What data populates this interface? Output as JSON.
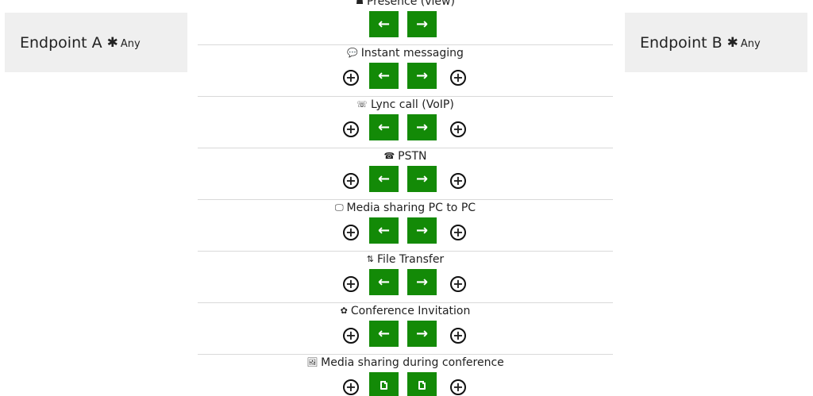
{
  "endpoint_a": {
    "title": "Endpoint A",
    "star": "✱",
    "scope": "Any"
  },
  "endpoint_b": {
    "title": "Endpoint B",
    "star": "✱",
    "scope": "Any"
  },
  "features": [
    {
      "label": "Presence (view)",
      "icon": "presence-icon",
      "glyph": "☗",
      "has_add": false,
      "button_type": "arrows"
    },
    {
      "label": "Instant messaging",
      "icon": "chat-icon",
      "glyph": "💬",
      "has_add": true,
      "button_type": "arrows"
    },
    {
      "label": "Lync call (VoIP)",
      "icon": "phone-icon",
      "glyph": "☏",
      "has_add": true,
      "button_type": "arrows"
    },
    {
      "label": "PSTN",
      "icon": "pstn-icon",
      "glyph": "☎",
      "has_add": true,
      "button_type": "arrows"
    },
    {
      "label": "Media sharing PC to PC",
      "icon": "monitor-icon",
      "glyph": "🖵",
      "has_add": true,
      "button_type": "arrows"
    },
    {
      "label": "File Transfer",
      "icon": "transfer-icon",
      "glyph": "⇅",
      "has_add": true,
      "button_type": "arrows"
    },
    {
      "label": "Conference Invitation",
      "icon": "conference-icon",
      "glyph": "✿",
      "has_add": true,
      "button_type": "arrows"
    },
    {
      "label": "Media sharing during conference",
      "icon": "media-conference-icon",
      "glyph": "🖼",
      "has_add": true,
      "button_type": "documents"
    }
  ],
  "controls": {
    "left_arrow": "←",
    "right_arrow": "→",
    "plus": "+"
  },
  "colors": {
    "button_green": "#138a07",
    "endpoint_bg": "#efefef",
    "divider": "#d9d9d9"
  }
}
